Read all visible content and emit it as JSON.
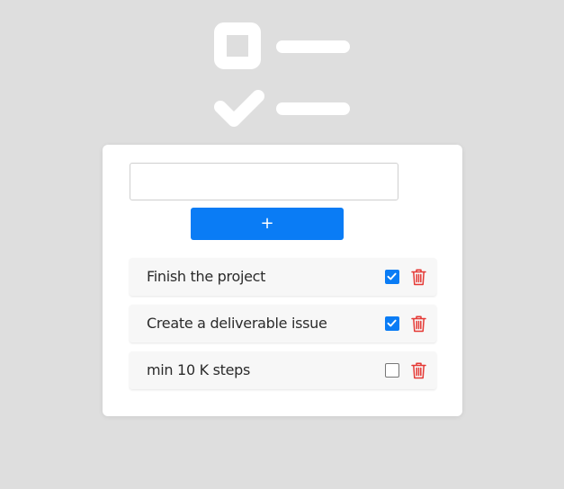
{
  "logo": {
    "icon": "checklist-icon",
    "color": "#ffffff"
  },
  "form": {
    "input_value": "",
    "add_button_label": "+"
  },
  "colors": {
    "accent": "#0a7cf5",
    "delete": "#e53935",
    "background": "#dedede"
  },
  "todos": [
    {
      "text": "Finish the project",
      "done": true
    },
    {
      "text": "Create a deliverable issue",
      "done": true
    },
    {
      "text": "min 10 K steps",
      "done": false
    }
  ]
}
